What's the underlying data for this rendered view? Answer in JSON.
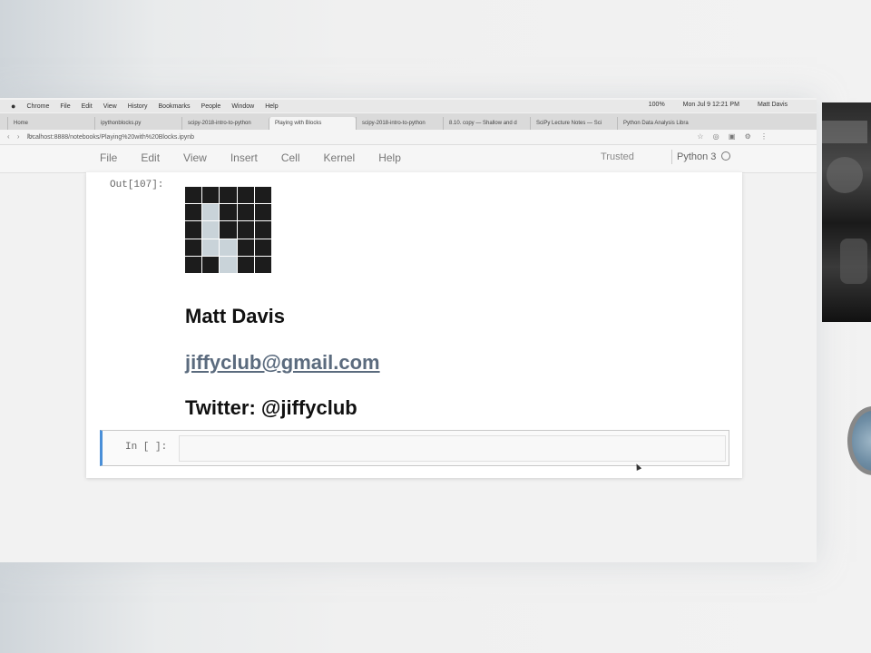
{
  "macos_menubar": {
    "apple": "",
    "items": [
      "Chrome",
      "File",
      "Edit",
      "View",
      "History",
      "Bookmarks",
      "People",
      "Window",
      "Help"
    ],
    "clock": "Mon Jul 9  12:21 PM",
    "user": "Matt Davis",
    "battery": "100%"
  },
  "browser": {
    "tabs": [
      {
        "label": "Home",
        "active": false
      },
      {
        "label": "ipythonblocks.py",
        "active": false
      },
      {
        "label": "scipy-2018-intro-to-python",
        "active": false
      },
      {
        "label": "Playing with Blocks",
        "active": true
      },
      {
        "label": "scipy-2018-intro-to-python",
        "active": false
      },
      {
        "label": "8.10. copy — Shallow and d",
        "active": false
      },
      {
        "label": "SciPy Lecture Notes — Sci",
        "active": false
      },
      {
        "label": "Python Data Analysis Libra",
        "active": false
      }
    ],
    "address": "localhost:8888/notebooks/Playing%20with%20Blocks.ipynb"
  },
  "jupyter": {
    "menu": [
      "File",
      "Edit",
      "View",
      "Insert",
      "Cell",
      "Kernel",
      "Help"
    ],
    "trusted": "Trusted",
    "kernel": "Python 3"
  },
  "output": {
    "prompt": "Out[107]:",
    "grid_lit": [
      [
        0,
        0,
        0,
        0,
        0
      ],
      [
        0,
        1,
        0,
        0,
        0
      ],
      [
        0,
        1,
        0,
        0,
        0
      ],
      [
        0,
        1,
        1,
        0,
        0
      ],
      [
        0,
        0,
        1,
        0,
        0
      ]
    ],
    "name": "Matt Davis",
    "email": "jiffyclub@gmail.com",
    "twitter": "Twitter: @jiffyclub"
  },
  "input_cell": {
    "prompt": "In [ ]:"
  },
  "colors": {
    "accent": "#4a8fd8",
    "link": "#5b6b7e",
    "block_dark": "#1c1c1c",
    "block_light": "#c9d3d9"
  }
}
